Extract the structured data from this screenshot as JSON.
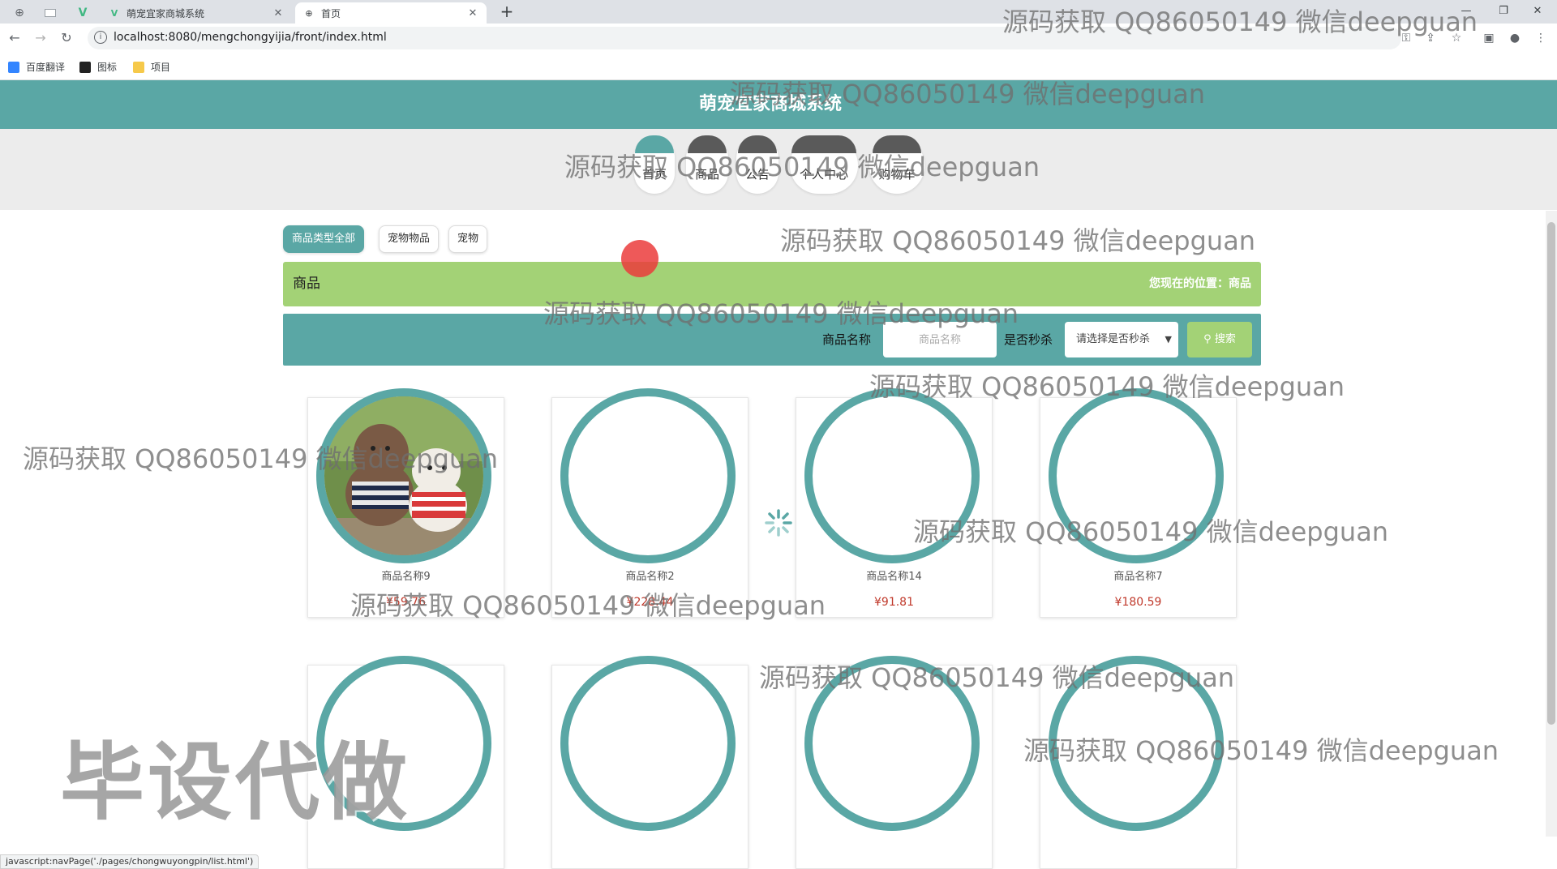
{
  "browser": {
    "tabs": [
      {
        "title": "萌宠宜家商城系统",
        "active": false
      },
      {
        "title": "首页",
        "active": true
      }
    ],
    "new_tab": "+",
    "url": "localhost:8080/mengchongyijia/front/index.html",
    "bookmarks": [
      "百度翻译",
      "图标",
      "项目"
    ],
    "status_text": "javascript:navPage('./pages/chongwuyongpin/list.html')"
  },
  "site": {
    "title": "萌宠宜家商城系统",
    "nav": [
      "首页",
      "商品",
      "公告",
      "个人中心",
      "购物车"
    ],
    "active_nav": "首页"
  },
  "categories": {
    "items": [
      "商品类型全部",
      "宠物物品",
      "宠物"
    ],
    "active": "商品类型全部"
  },
  "breadcrumb": {
    "title": "商品",
    "location": "您现在的位置：商品"
  },
  "search": {
    "name_label": "商品名称",
    "name_placeholder": "商品名称",
    "flash_label": "是否秒杀",
    "flash_select": "请选择是否秒杀",
    "button": "搜索"
  },
  "products": [
    {
      "name": "商品名称9",
      "price": "¥59.76",
      "has_image": true
    },
    {
      "name": "商品名称2",
      "price": "¥228.44",
      "has_image": false
    },
    {
      "name": "商品名称14",
      "price": "¥91.81",
      "has_image": false
    },
    {
      "name": "商品名称7",
      "price": "¥180.59",
      "has_image": false
    },
    {
      "name": "",
      "price": "",
      "has_image": false
    },
    {
      "name": "",
      "price": "",
      "has_image": false
    },
    {
      "name": "",
      "price": "",
      "has_image": false
    },
    {
      "name": "",
      "price": "",
      "has_image": false
    }
  ],
  "watermarks": {
    "text": "源码获取 QQ86050149 微信deepguan",
    "big": "毕设代做"
  },
  "colors": {
    "teal": "#5aa7a5",
    "green": "#a3d276",
    "price_red": "#c0392b"
  }
}
